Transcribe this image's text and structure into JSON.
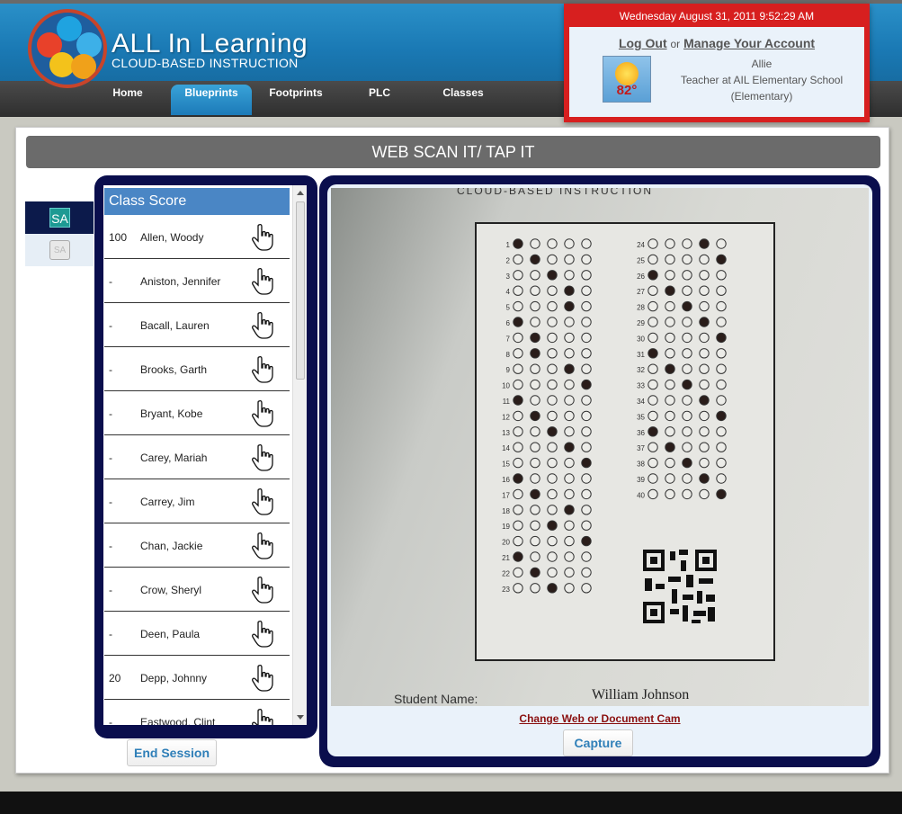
{
  "header": {
    "title": "ALL In Learning",
    "subtitle": "CLOUD-BASED INSTRUCTION",
    "nav": [
      {
        "label": "Home",
        "active": false
      },
      {
        "label": "Blueprints",
        "active": true
      },
      {
        "label": "Footprints",
        "active": false
      },
      {
        "label": "PLC",
        "active": false
      },
      {
        "label": "Classes",
        "active": false
      }
    ]
  },
  "account": {
    "datetime": "Wednesday August 31, 2011 9:52:29 AM",
    "logout": "Log Out",
    "or": "or",
    "manage": "Manage Your Account",
    "temperature": "82°",
    "user": "Allie",
    "role_line1": "Teacher at AIL Elementary School",
    "role_line2": "(Elementary)"
  },
  "page": {
    "title": "WEB SCAN IT/ TAP IT",
    "side_tabs": [
      "SA",
      "SA"
    ]
  },
  "class_score": {
    "heading": "Class Score",
    "rows": [
      {
        "score": "100",
        "name": "Allen, Woody"
      },
      {
        "score": "-",
        "name": "Aniston, Jennifer"
      },
      {
        "score": "-",
        "name": "Bacall, Lauren"
      },
      {
        "score": "-",
        "name": "Brooks, Garth"
      },
      {
        "score": "-",
        "name": "Bryant, Kobe"
      },
      {
        "score": "-",
        "name": "Carey, Mariah"
      },
      {
        "score": "-",
        "name": "Carrey, Jim"
      },
      {
        "score": "-",
        "name": "Chan, Jackie"
      },
      {
        "score": "-",
        "name": "Crow, Sheryl"
      },
      {
        "score": "-",
        "name": "Deen, Paula"
      },
      {
        "score": "20",
        "name": "Depp, Johnny"
      },
      {
        "score": "-",
        "name": "Eastwood, Clint"
      }
    ],
    "end_session": "End Session"
  },
  "camera": {
    "brand_text": "CLOUD-BASED INSTRUCTION",
    "student_label": "Student Name:",
    "student_value": "William Johnson",
    "change_link": "Change Web or Document Cam",
    "capture": "Capture",
    "left_questions": [
      "1",
      "2",
      "3",
      "4",
      "5",
      "6",
      "7",
      "8",
      "9",
      "10",
      "11",
      "12",
      "13",
      "14",
      "15",
      "16",
      "17",
      "18",
      "19",
      "20",
      "21",
      "22",
      "23"
    ],
    "right_questions": [
      "24",
      "25",
      "26",
      "27",
      "28",
      "29",
      "30",
      "31",
      "32",
      "33",
      "34",
      "35",
      "36",
      "37",
      "38",
      "39",
      "40"
    ],
    "left_answers": [
      0,
      1,
      2,
      3,
      3,
      0,
      1,
      1,
      3,
      4,
      0,
      1,
      2,
      3,
      4,
      0,
      1,
      3,
      2,
      4,
      0,
      1,
      2
    ],
    "right_answers": [
      3,
      4,
      0,
      1,
      2,
      3,
      4,
      0,
      1,
      2,
      3,
      4,
      0,
      1,
      2,
      3,
      4
    ]
  },
  "colors": {
    "header_blue": "#1a79b4",
    "frame_navy": "#0a0e4d",
    "account_red": "#d71f1f",
    "list_head": "#4a86c5"
  }
}
